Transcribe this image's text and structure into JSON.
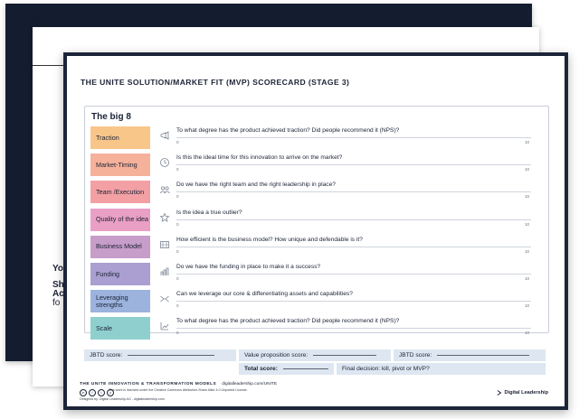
{
  "background_sheets": {
    "fragment_lines": [
      "Yo",
      "Sh",
      "Ac",
      "fo"
    ]
  },
  "card": {
    "title": "THE UNITE SOLUTION/MARKET FIT (MVP) SCORECARD (STAGE 3)",
    "heading": "The big 8",
    "scale": {
      "min": "0",
      "max": "10"
    },
    "rows": [
      {
        "label": "Traction",
        "color": "#f9c68a",
        "icon": "megaphone-icon",
        "question": "To what degree has the product achieved traction? Did people recommend it (NPS)?"
      },
      {
        "label": "Market-Timing",
        "color": "#f6b19a",
        "icon": "clock-icon",
        "question": "Is this the ideal time for this innovation to arrive on the market?"
      },
      {
        "label": "Team /Execution",
        "color": "#f3a0a4",
        "icon": "team-icon",
        "question": "Do we have the right team and the right leadership in place?"
      },
      {
        "label": "Quality of the idea",
        "color": "#ea9fc5",
        "icon": "star-icon",
        "question": "Is the idea a true outlier?"
      },
      {
        "label": "Business Model",
        "color": "#c79dc9",
        "icon": "business-model-icon",
        "question": "How efficient is the business model? How unique and defendable is it?"
      },
      {
        "label": "Funding",
        "color": "#aa9fd0",
        "icon": "funding-icon",
        "question": "Do we have the funding in place to make it a success?"
      },
      {
        "label": "Leveraging strengths",
        "color": "#9bb3dd",
        "icon": "leverage-icon",
        "question": "Can we leverage our core & differentiating assets and capabilities?"
      },
      {
        "label": "Scale",
        "color": "#8fd0cf",
        "icon": "scale-icon",
        "question": "To what degree has the product achieved traction? Did people recommend it (NPS)?"
      }
    ],
    "scores": {
      "jbtd_left": "JBTD score:",
      "value_proposition": "Value proposition score:",
      "jbtd_right": "JBTD score:",
      "total": "Total score:",
      "final_decision": "Final decision: kill, pivot or MVP?"
    },
    "footer": {
      "title": "THE UNITE INNOVATION & TRANSFORMATION MODELS",
      "url": "digitalleadership.com/UNITE",
      "license": "This work is licensed under the Creative Commons Attribution-Share Alike 4.0 Unported License.",
      "designed_by": "Designed by: Digital Leadership AG - digitalleadership.com",
      "brand": "Digital Leadership",
      "social": [
        "in",
        "f",
        "t",
        "y"
      ]
    }
  }
}
